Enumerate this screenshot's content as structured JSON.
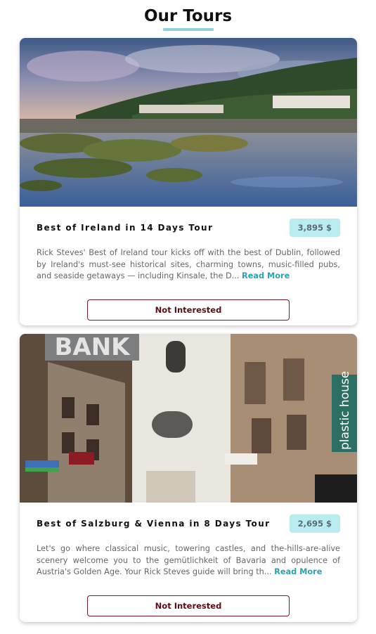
{
  "header": {
    "title": "Our Tours"
  },
  "tours": [
    {
      "name": "Best of Ireland in 14 Days Tour",
      "price": "3,895 $",
      "description": "Rick Steves' Best of Ireland tour kicks off with the best of Dublin, followed by Ireland's must-see historical sites, charming towns, music-filled pubs, and seaside getaways — including Kinsale, the D...",
      "read_more": "Read More",
      "button_label": "Not Interested"
    },
    {
      "name": "Best of Salzburg & Vienna in 8 Days Tour",
      "price": "2,695 $",
      "description": "Let's go where classical music, towering castles, and the-hills-are-alive scenery welcome you to the gemütlichkeit of Bavaria and opulence of Austria's Golden Age. Your Rick Steves guide will bring th...",
      "read_more": "Read More",
      "button_label": "Not Interested",
      "image_signs": {
        "bank": "BANK",
        "shop": "plastic house"
      }
    }
  ],
  "colors": {
    "accent": "#8fd3de",
    "price_bg": "#b9ecf1",
    "read_more": "#2aa3ad",
    "button_border": "#7a1b24"
  }
}
